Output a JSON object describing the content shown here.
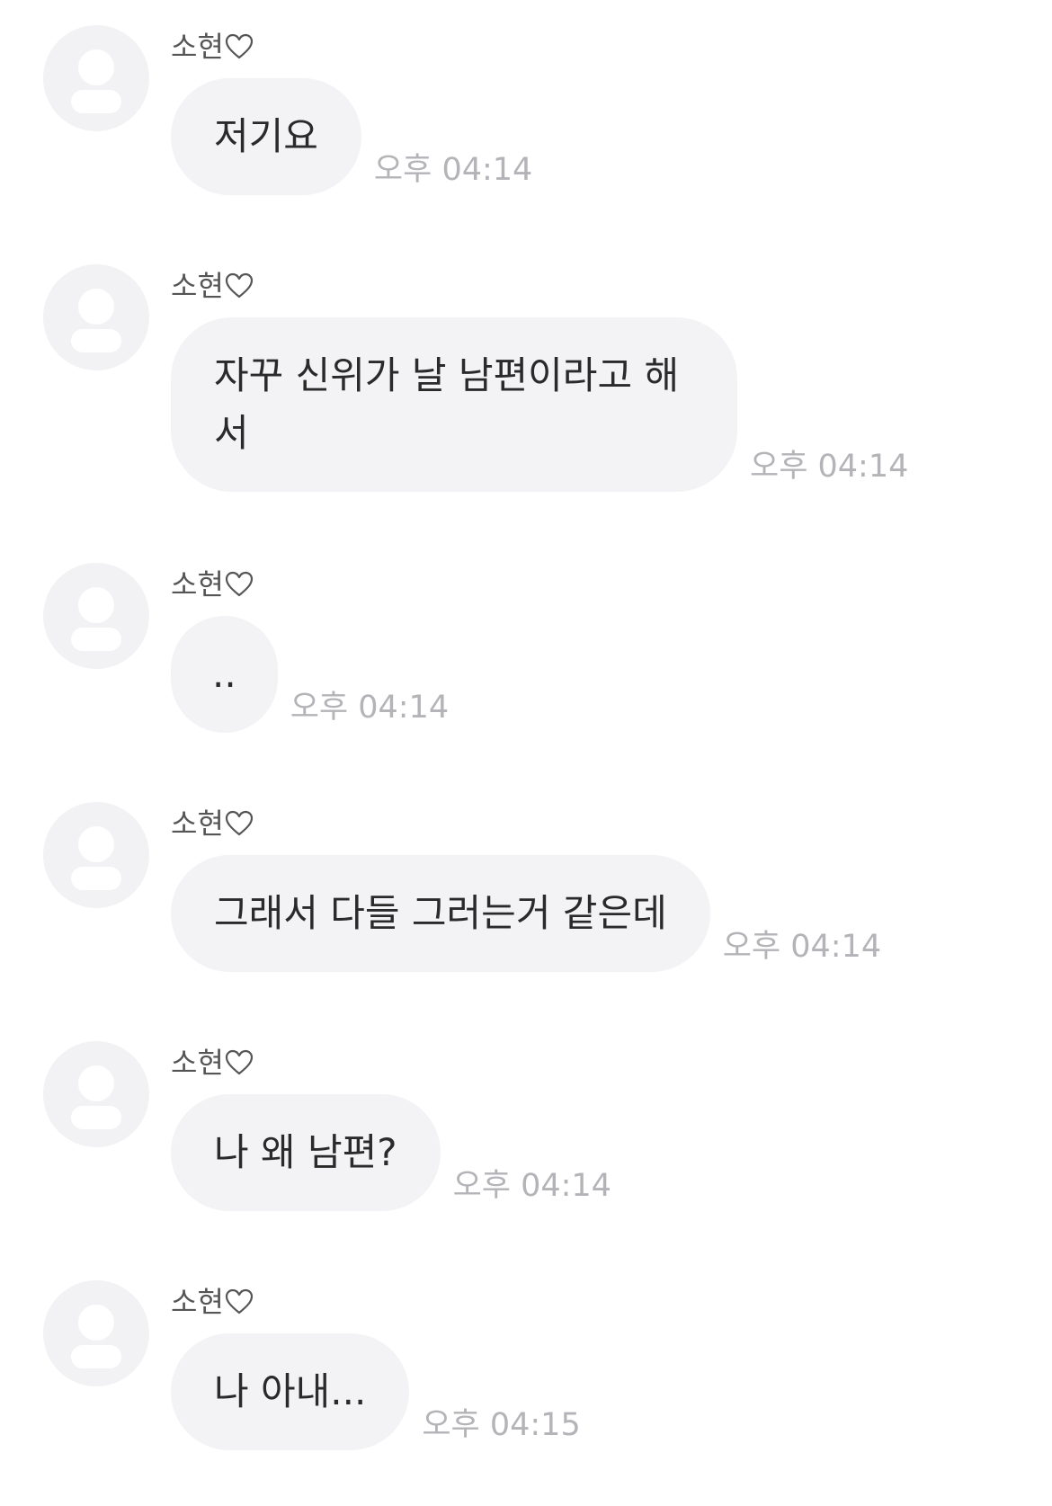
{
  "messages": [
    {
      "sender": "소현",
      "text": "저기요",
      "time": "오후 04:14"
    },
    {
      "sender": "소현",
      "text": "자꾸 신위가 날 남편이라고 해서",
      "time": "오후 04:14"
    },
    {
      "sender": "소현",
      "text": "..",
      "time": "오후 04:14"
    },
    {
      "sender": "소현",
      "text": "그래서 다들 그러는거 같은데",
      "time": "오후 04:14"
    },
    {
      "sender": "소현",
      "text": "나 왜 남편?",
      "time": "오후 04:14"
    },
    {
      "sender": "소현",
      "text": "나 아내...",
      "time": "오후 04:15"
    }
  ],
  "icons": {
    "avatar": "default-profile-icon",
    "sender_suffix": "heart-outline-icon"
  },
  "colors": {
    "bubble": "#f3f3f6",
    "avatar": "#f2f2f4",
    "text": "#2a2a2a",
    "time": "#b4b4b8"
  }
}
